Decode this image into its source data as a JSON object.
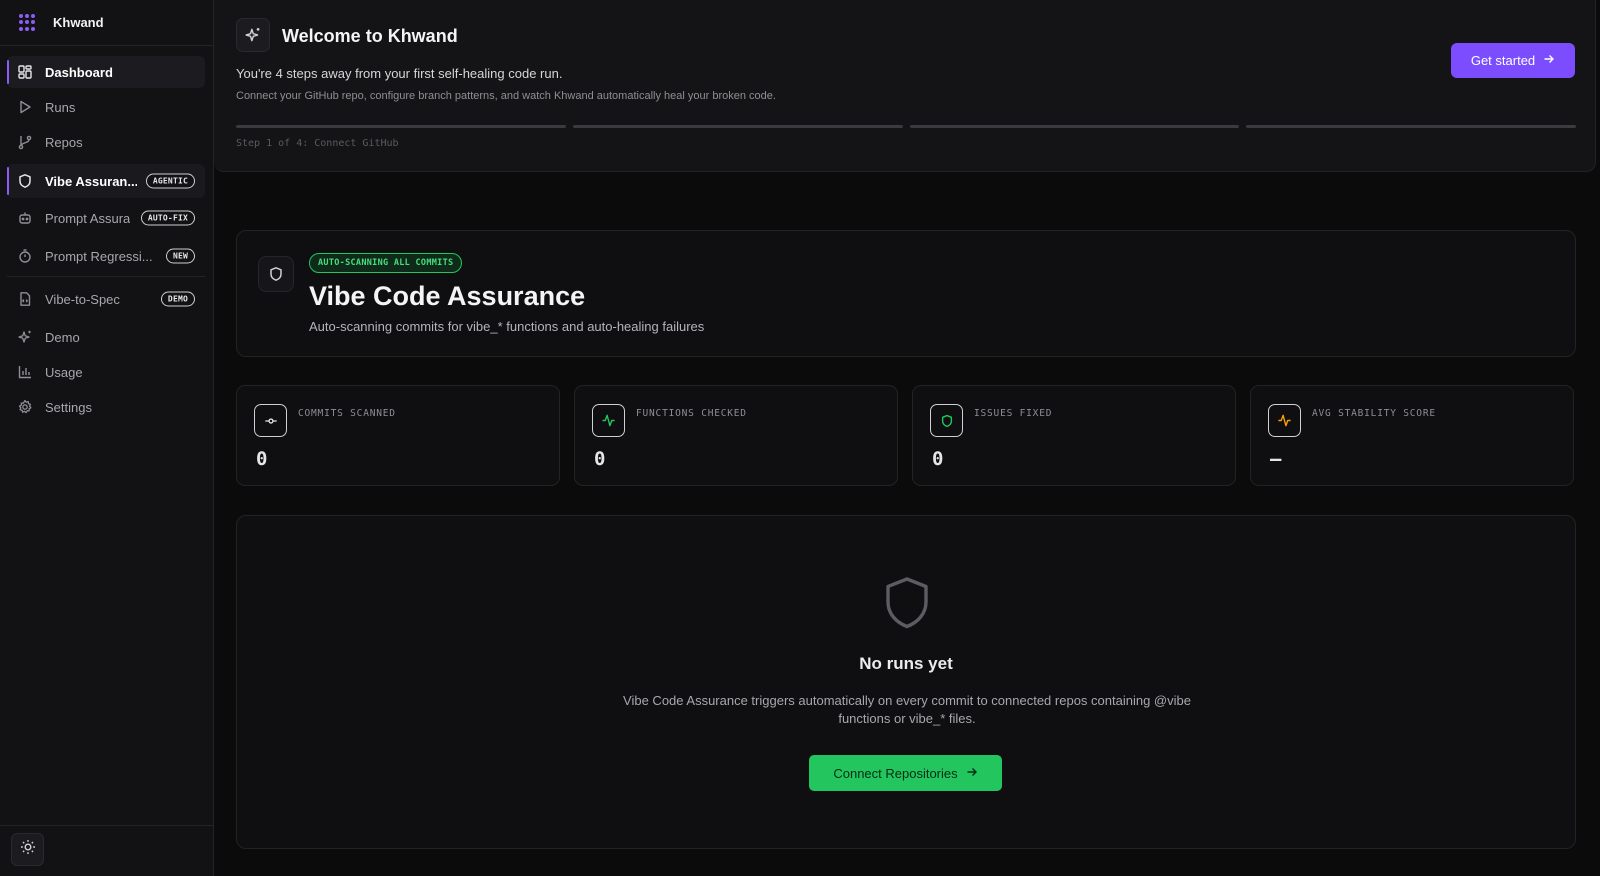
{
  "app": {
    "name": "Khwand"
  },
  "sidebar": {
    "items": [
      {
        "label": "Dashboard",
        "icon": "dashboard-icon"
      },
      {
        "label": "Runs",
        "icon": "play-icon"
      },
      {
        "label": "Repos",
        "icon": "git-branch-icon"
      },
      {
        "label": "Vibe Assuran...",
        "icon": "shield-icon",
        "badge": "AGENTIC"
      },
      {
        "label": "Prompt Assura",
        "icon": "bot-icon",
        "badge": "AUTO-FIX"
      },
      {
        "label": "Prompt Regressi...",
        "icon": "timer-icon",
        "badge": "NEW"
      },
      {
        "label": "Vibe-to-Spec",
        "icon": "file-code-icon",
        "badge": "DEMO"
      },
      {
        "label": "Demo",
        "icon": "sparkles-icon"
      },
      {
        "label": "Usage",
        "icon": "bar-chart-icon"
      },
      {
        "label": "Settings",
        "icon": "gear-icon"
      }
    ],
    "theme_toggle_icon": "sun-icon"
  },
  "welcome": {
    "title": "Welcome to Khwand",
    "subtitle": "You're 4 steps away from your first self-healing code run.",
    "description": "Connect your GitHub repo, configure branch patterns, and watch Khwand automatically heal your broken code.",
    "cta": "Get started",
    "step_text": "Step 1 of 4: Connect GitHub",
    "steps_total": 4,
    "steps_done": 0
  },
  "hero": {
    "pill": "AUTO-SCANNING ALL COMMITS",
    "title": "Vibe Code Assurance",
    "subtitle": "Auto-scanning commits for vibe_* functions and auto-healing failures"
  },
  "stats": [
    {
      "label": "COMMITS SCANNED",
      "value": "0",
      "icon": "git-commit-icon",
      "color": "#e6e6e8"
    },
    {
      "label": "FUNCTIONS CHECKED",
      "value": "0",
      "icon": "activity-icon",
      "color": "#22c55e"
    },
    {
      "label": "ISSUES FIXED",
      "value": "0",
      "icon": "shield-icon",
      "color": "#22c55e"
    },
    {
      "label": "AVG STABILITY SCORE",
      "value": "—",
      "icon": "activity-icon",
      "color": "#f59e0b"
    }
  ],
  "empty_state": {
    "title": "No runs yet",
    "description": "Vibe Code Assurance triggers automatically on every commit to connected repos containing @vibe functions or vibe_* files.",
    "cta": "Connect Repositories"
  },
  "colors": {
    "accent": "#7c4dff",
    "success": "#22c55e",
    "warning": "#f59e0b"
  }
}
